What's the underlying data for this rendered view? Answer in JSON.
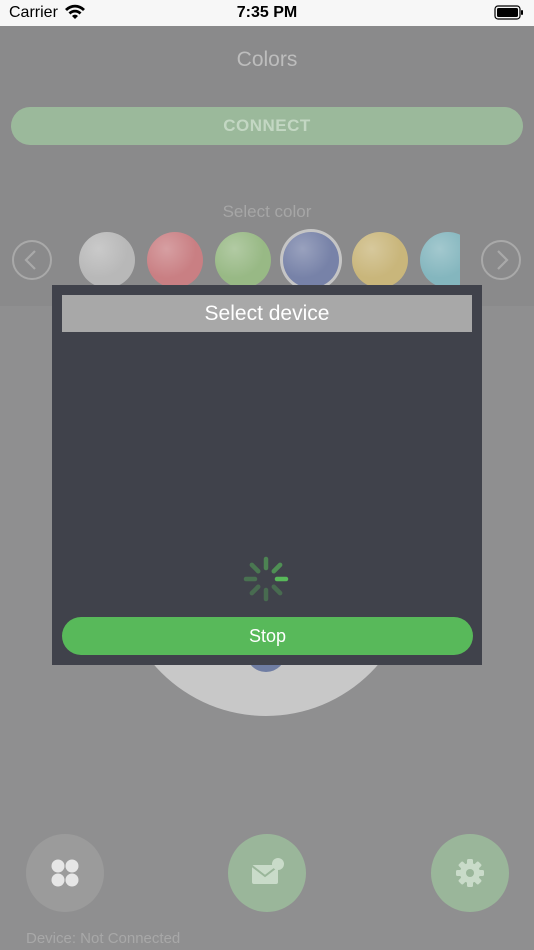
{
  "status_bar": {
    "carrier": "Carrier",
    "time": "7:35 PM",
    "wifi_icon": "wifi-icon",
    "battery_icon": "battery-icon"
  },
  "header": {
    "title": "Colors"
  },
  "connect_button": {
    "label": "CONNECT"
  },
  "color_picker": {
    "label": "Select color",
    "prev_icon": "chevron-left-icon",
    "next_icon": "chevron-right-icon",
    "swatches": [
      {
        "color": "#b8b8b8",
        "selected": false
      },
      {
        "color": "#c97f83",
        "selected": false
      },
      {
        "color": "#98b985",
        "selected": false
      },
      {
        "color": "#7782a8",
        "selected": true
      },
      {
        "color": "#c9b67b",
        "selected": false
      },
      {
        "color": "#84b6be",
        "selected": false
      }
    ]
  },
  "modal": {
    "title": "Select device",
    "spinner_icon": "loading-spinner-icon",
    "stop_label": "Stop"
  },
  "bottom_bar": {
    "left_icon": "grid-icon",
    "center_icon": "mail-notification-icon",
    "right_icon": "gear-icon"
  },
  "device_status": "Device: Not Connected",
  "colors": {
    "accent_green": "#58b95a",
    "modal_bg": "#40424b"
  }
}
